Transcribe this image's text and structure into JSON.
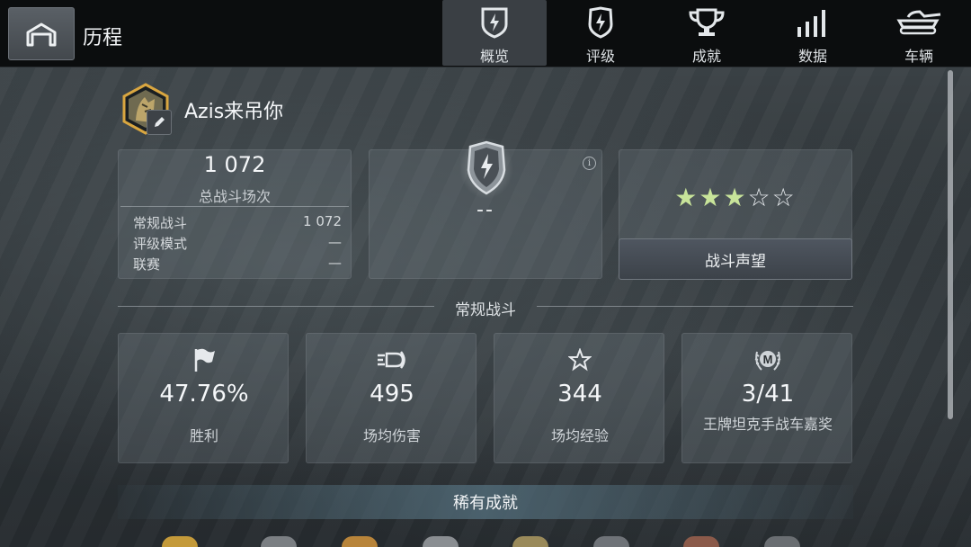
{
  "header": {
    "title": "历程",
    "tabs": [
      {
        "label": "概览",
        "icon": "shield-bolt-icon",
        "active": true
      },
      {
        "label": "评级",
        "icon": "rating-shield-icon",
        "active": false
      },
      {
        "label": "成就",
        "icon": "trophy-icon",
        "active": false
      },
      {
        "label": "数据",
        "icon": "bar-chart-icon",
        "active": false
      },
      {
        "label": "车辆",
        "icon": "tank-icon",
        "active": false
      }
    ]
  },
  "profile": {
    "name": "Azis来吊你"
  },
  "battles": {
    "total": "1 072",
    "total_label": "总战斗场次",
    "rows": [
      {
        "name": "常规战斗",
        "value": "1 072"
      },
      {
        "name": "评级模式",
        "value": "—"
      },
      {
        "name": "联赛",
        "value": "—"
      }
    ]
  },
  "rank": {
    "value": "--",
    "info": "i"
  },
  "reputation": {
    "stars_filled": 3,
    "stars_total": 5,
    "button_label": "战斗声望",
    "star_color": "#c8e49a"
  },
  "regular": {
    "section_title": "常规战斗",
    "stats": [
      {
        "icon": "flag-icon",
        "value": "47.76%",
        "label": "胜利"
      },
      {
        "icon": "damage-shell-icon",
        "value": "495",
        "label": "场均伤害"
      },
      {
        "icon": "star-outline-icon",
        "value": "344",
        "label": "场均经验"
      },
      {
        "icon": "mastery-badge-icon",
        "value": "3/41",
        "label": "王牌坦克手战车嘉奖"
      }
    ]
  },
  "rare": {
    "title": "稀有成就"
  }
}
